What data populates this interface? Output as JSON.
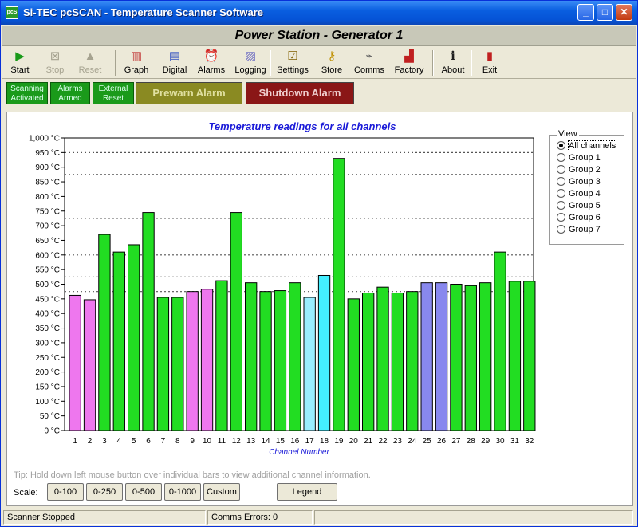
{
  "window": {
    "title": "Si-TEC pcSCAN - Temperature Scanner Software",
    "icon_text": "pcS",
    "controls": {
      "minimize": "_",
      "maximize": "□",
      "close": "✕"
    }
  },
  "header": {
    "title": "Power Station - Generator 1"
  },
  "toolbar": {
    "items": [
      {
        "label": "Start",
        "icon": "play-icon",
        "glyph": "▶",
        "color": "#1a9a1a",
        "enabled": true
      },
      {
        "label": "Stop",
        "icon": "stop-icon",
        "glyph": "⊠",
        "color": "#a6a390",
        "enabled": false
      },
      {
        "label": "Reset",
        "icon": "reset-icon",
        "glyph": "▲",
        "color": "#a6a390",
        "enabled": false
      },
      {
        "label": "Graph",
        "icon": "graph-icon",
        "glyph": "▥",
        "color": "#c03030",
        "enabled": true
      },
      {
        "label": "Digital",
        "icon": "digital-icon",
        "glyph": "▤",
        "color": "#3050c0",
        "enabled": true
      },
      {
        "label": "Alarms",
        "icon": "alarm-clock-icon",
        "glyph": "⏰",
        "color": "#c02020",
        "enabled": true
      },
      {
        "label": "Logging",
        "icon": "logging-icon",
        "glyph": "▨",
        "color": "#6060c0",
        "enabled": true
      },
      {
        "label": "Settings",
        "icon": "settings-icon",
        "glyph": "☑",
        "color": "#806000",
        "enabled": true
      },
      {
        "label": "Store",
        "icon": "key-icon",
        "glyph": "⚷",
        "color": "#c09000",
        "enabled": true
      },
      {
        "label": "Comms",
        "icon": "comms-icon",
        "glyph": "⌁",
        "color": "#606060",
        "enabled": true
      },
      {
        "label": "Factory",
        "icon": "factory-icon",
        "glyph": "▟",
        "color": "#c02020",
        "enabled": true
      },
      {
        "label": "About",
        "icon": "info-icon",
        "glyph": "ℹ",
        "color": "#202020",
        "enabled": true
      },
      {
        "label": "Exit",
        "icon": "exit-icon",
        "glyph": "▮",
        "color": "#c02020",
        "enabled": true
      }
    ]
  },
  "indicators": {
    "scanning": "Scanning Activated",
    "alarms": "Alarms Armed",
    "external": "External Reset",
    "prewarn": "Prewarn Alarm",
    "shutdown": "Shutdown Alarm",
    "prewarn_bg": "#8a8a22",
    "prewarn_fg": "#e0e0a0",
    "shutdown_bg": "#8a1616",
    "shutdown_fg": "#f0d0d0"
  },
  "chart_data": {
    "type": "bar",
    "title": "Temperature readings for all channels",
    "xlabel": "Channel Number",
    "ylabel": "",
    "ylim": [
      0,
      1000
    ],
    "ytick_step": 50,
    "ytick_suffix": " °C",
    "grid": "dotted horizontal at 475, 525, 600, 725, 875, 950",
    "grid_lines": [
      475,
      525,
      600,
      725,
      875,
      950
    ],
    "categories": [
      "1",
      "2",
      "3",
      "4",
      "5",
      "6",
      "7",
      "8",
      "9",
      "10",
      "11",
      "12",
      "13",
      "14",
      "15",
      "16",
      "17",
      "18",
      "19",
      "20",
      "21",
      "22",
      "23",
      "24",
      "25",
      "26",
      "27",
      "28",
      "29",
      "30",
      "31",
      "32"
    ],
    "values": [
      462,
      447,
      670,
      610,
      635,
      745,
      455,
      455,
      475,
      483,
      512,
      745,
      505,
      475,
      478,
      505,
      455,
      530,
      930,
      450,
      470,
      490,
      470,
      475,
      505,
      505,
      500,
      495,
      505,
      610,
      510,
      510
    ],
    "colors": [
      "#ee77ee",
      "#ee77ee",
      "#22dd22",
      "#22dd22",
      "#22dd22",
      "#22dd22",
      "#22dd22",
      "#22dd22",
      "#ee77ee",
      "#ee77ee",
      "#22dd22",
      "#22dd22",
      "#22dd22",
      "#22dd22",
      "#22dd22",
      "#22dd22",
      "#99eeff",
      "#44eeff",
      "#22dd22",
      "#22dd22",
      "#22dd22",
      "#22dd22",
      "#22dd22",
      "#22dd22",
      "#8888ee",
      "#8888ee",
      "#22dd22",
      "#22dd22",
      "#22dd22",
      "#22dd22",
      "#22dd22",
      "#22dd22"
    ]
  },
  "view": {
    "legend": "View",
    "options": [
      "All channels",
      "Group 1",
      "Group 2",
      "Group 3",
      "Group 4",
      "Group 5",
      "Group 6",
      "Group 7"
    ],
    "selected": 0
  },
  "tip": "Tip: Hold down left mouse button over individual bars to view additional channel information.",
  "scale": {
    "label": "Scale:",
    "buttons": [
      "0-100",
      "0-250",
      "0-500",
      "0-1000",
      "Custom"
    ],
    "legend_button": "Legend"
  },
  "statusbar": {
    "scanner": "Scanner Stopped",
    "comms": "Comms Errors: 0"
  }
}
